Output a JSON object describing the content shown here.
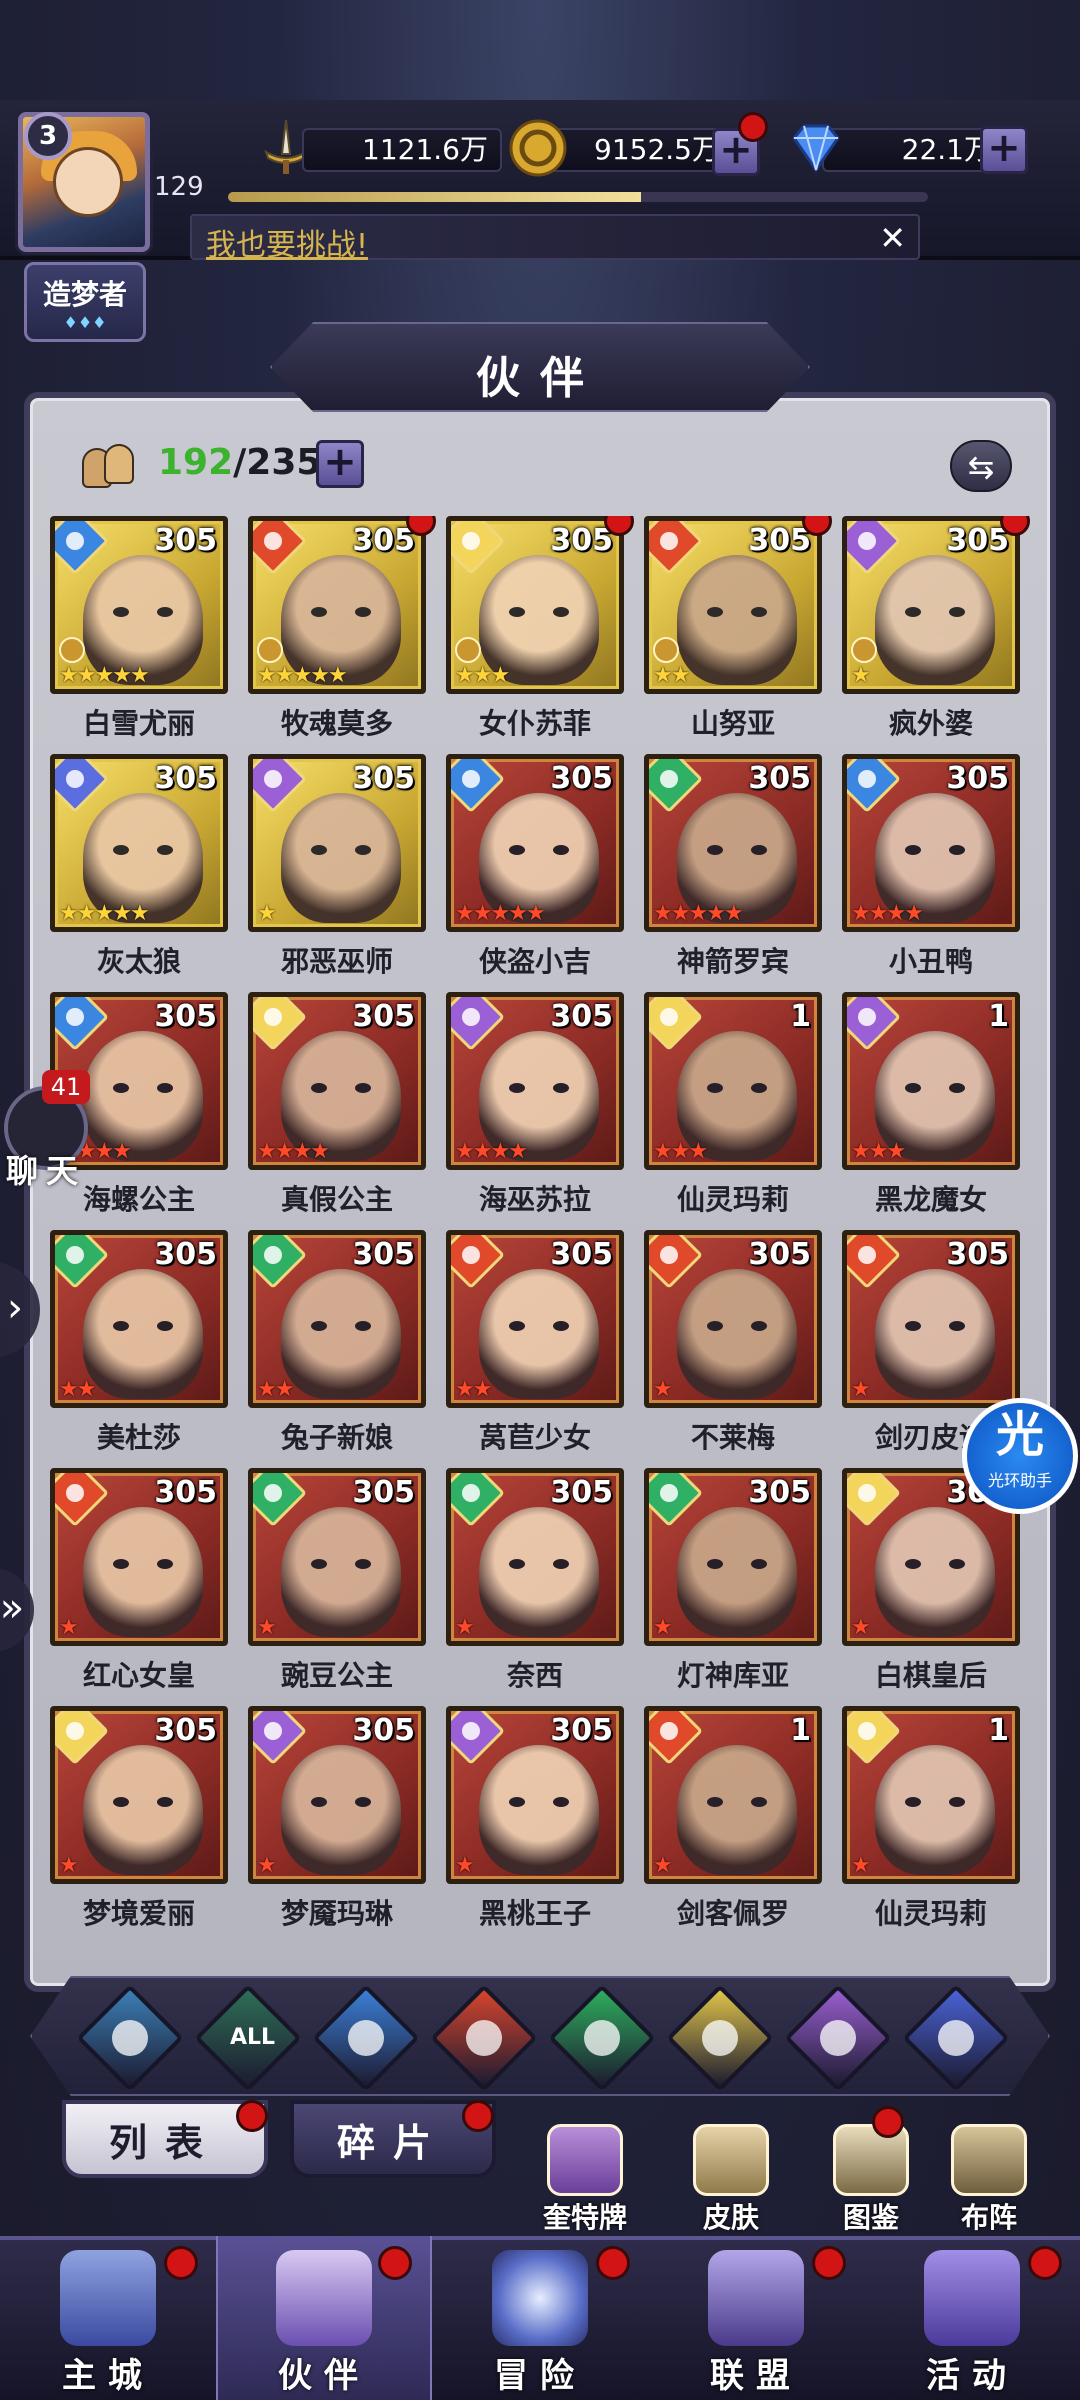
{
  "player": {
    "vip_level": "3",
    "level": "129",
    "title": "造梦者",
    "xp_progress": 0.59
  },
  "resources": {
    "power": "1121.6万",
    "gold": "9152.5万",
    "diamond": "22.1万"
  },
  "challenge_banner": {
    "text": "我也要挑战!",
    "close": "✕"
  },
  "page_title": "伙伴",
  "roster": {
    "current": "192",
    "total": "/235"
  },
  "chat": {
    "label": "聊天",
    "badge": "41"
  },
  "helper": {
    "big": "光",
    "small": "光环助手"
  },
  "heroes": [
    {
      "name": "白雪尤丽",
      "level": "305",
      "frame": "gold",
      "element": "water",
      "stars": 5,
      "star_color": "gold",
      "dot": false,
      "crown": true
    },
    {
      "name": "牧魂莫多",
      "level": "305",
      "frame": "gold",
      "element": "fire",
      "stars": 5,
      "star_color": "gold",
      "dot": true,
      "crown": true
    },
    {
      "name": "女仆苏菲",
      "level": "305",
      "frame": "gold",
      "element": "light",
      "stars": 3,
      "star_color": "gold",
      "dot": true,
      "crown": true
    },
    {
      "name": "山努亚",
      "level": "305",
      "frame": "gold",
      "element": "fire",
      "stars": 2,
      "star_color": "gold",
      "dot": true,
      "crown": true
    },
    {
      "name": "疯外婆",
      "level": "305",
      "frame": "gold",
      "element": "dark",
      "stars": 1,
      "star_color": "gold",
      "dot": true,
      "crown": true
    },
    {
      "name": "灰太狼",
      "level": "305",
      "frame": "gold",
      "element": "cosmic",
      "stars": 5,
      "star_color": "gold",
      "dot": false,
      "crown": false
    },
    {
      "name": "邪恶巫师",
      "level": "305",
      "frame": "gold",
      "element": "dark",
      "stars": 1,
      "star_color": "gold",
      "dot": false,
      "crown": false
    },
    {
      "name": "侠盗小吉",
      "level": "305",
      "frame": "red",
      "element": "water",
      "stars": 5,
      "star_color": "red",
      "dot": false,
      "crown": false
    },
    {
      "name": "神箭罗宾",
      "level": "305",
      "frame": "red",
      "element": "wind",
      "stars": 5,
      "star_color": "red",
      "dot": false,
      "crown": false
    },
    {
      "name": "小丑鸭",
      "level": "305",
      "frame": "red",
      "element": "water",
      "stars": 4,
      "star_color": "red",
      "dot": false,
      "crown": false
    },
    {
      "name": "海螺公主",
      "level": "305",
      "frame": "red",
      "element": "water",
      "stars": 4,
      "star_color": "red",
      "dot": false,
      "crown": false
    },
    {
      "name": "真假公主",
      "level": "305",
      "frame": "red",
      "element": "light",
      "stars": 4,
      "star_color": "red",
      "dot": false,
      "crown": false
    },
    {
      "name": "海巫苏拉",
      "level": "305",
      "frame": "red",
      "element": "dark",
      "stars": 4,
      "star_color": "red",
      "dot": false,
      "crown": false
    },
    {
      "name": "仙灵玛莉",
      "level": "1",
      "frame": "red",
      "element": "light",
      "stars": 3,
      "star_color": "red",
      "dot": false,
      "crown": false
    },
    {
      "name": "黑龙魔女",
      "level": "1",
      "frame": "red",
      "element": "dark",
      "stars": 3,
      "star_color": "red",
      "dot": false,
      "crown": false
    },
    {
      "name": "美杜莎",
      "level": "305",
      "frame": "red",
      "element": "wind",
      "stars": 2,
      "star_color": "red",
      "dot": false,
      "crown": false
    },
    {
      "name": "兔子新娘",
      "level": "305",
      "frame": "red",
      "element": "wind",
      "stars": 2,
      "star_color": "red",
      "dot": false,
      "crown": false
    },
    {
      "name": "莴苣少女",
      "level": "305",
      "frame": "red",
      "element": "fire",
      "stars": 2,
      "star_color": "red",
      "dot": false,
      "crown": false
    },
    {
      "name": "不莱梅",
      "level": "305",
      "frame": "red",
      "element": "fire",
      "stars": 1,
      "star_color": "red",
      "dot": false,
      "crown": false
    },
    {
      "name": "剑刃皮诺",
      "level": "305",
      "frame": "red",
      "element": "fire",
      "stars": 1,
      "star_color": "red",
      "dot": false,
      "crown": false
    },
    {
      "name": "红心女皇",
      "level": "305",
      "frame": "red",
      "element": "fire",
      "stars": 1,
      "star_color": "red",
      "dot": false,
      "crown": false
    },
    {
      "name": "豌豆公主",
      "level": "305",
      "frame": "red",
      "element": "wind",
      "stars": 1,
      "star_color": "red",
      "dot": false,
      "crown": false
    },
    {
      "name": "奈西",
      "level": "305",
      "frame": "red",
      "element": "wind",
      "stars": 1,
      "star_color": "red",
      "dot": false,
      "crown": false
    },
    {
      "name": "灯神库亚",
      "level": "305",
      "frame": "red",
      "element": "wind",
      "stars": 1,
      "star_color": "red",
      "dot": false,
      "crown": false
    },
    {
      "name": "白棋皇后",
      "level": "305",
      "frame": "red",
      "element": "light",
      "stars": 1,
      "star_color": "red",
      "dot": false,
      "crown": false
    },
    {
      "name": "梦境爱丽",
      "level": "305",
      "frame": "red",
      "element": "light",
      "stars": 1,
      "star_color": "red",
      "dot": false,
      "crown": false
    },
    {
      "name": "梦魇玛琳",
      "level": "305",
      "frame": "red",
      "element": "dark",
      "stars": 1,
      "star_color": "red",
      "dot": false,
      "crown": false
    },
    {
      "name": "黑桃王子",
      "level": "305",
      "frame": "red",
      "element": "dark",
      "stars": 1,
      "star_color": "red",
      "dot": false,
      "crown": false
    },
    {
      "name": "剑客佩罗",
      "level": "1",
      "frame": "red",
      "element": "fire",
      "stars": 1,
      "star_color": "red",
      "dot": false,
      "crown": false
    },
    {
      "name": "仙灵玛莉",
      "level": "1",
      "frame": "red",
      "element": "light",
      "stars": 1,
      "star_color": "red",
      "dot": false,
      "crown": false
    }
  ],
  "filters": [
    {
      "id": "wing",
      "label": "",
      "color": "#3b7fb6"
    },
    {
      "id": "all",
      "label": "ALL",
      "color": "#2e6f56"
    },
    {
      "id": "water",
      "label": "",
      "color": "#3c7fd6"
    },
    {
      "id": "fire",
      "label": "",
      "color": "#d6452e"
    },
    {
      "id": "wind",
      "label": "",
      "color": "#2fae5e"
    },
    {
      "id": "light",
      "label": "",
      "color": "#e0c44a"
    },
    {
      "id": "dark",
      "label": "",
      "color": "#9a5fd0"
    },
    {
      "id": "cosmic",
      "label": "",
      "color": "#4a63d6"
    }
  ],
  "tabs": {
    "list": "列表",
    "fragments": "碎片"
  },
  "tools": {
    "cards": "奎特牌",
    "skin": "皮肤",
    "codex": "图鉴",
    "formation": "布阵"
  },
  "nav": {
    "castle": "主城",
    "partners": "伙伴",
    "adventure": "冒险",
    "alliance": "联盟",
    "events": "活动"
  },
  "colors": {
    "water": "#3b86e0",
    "fire": "#e04a2a",
    "light": "#f2d55a",
    "dark": "#9b5fd6",
    "wind": "#2fb064",
    "cosmic": "#5b6ee0"
  }
}
